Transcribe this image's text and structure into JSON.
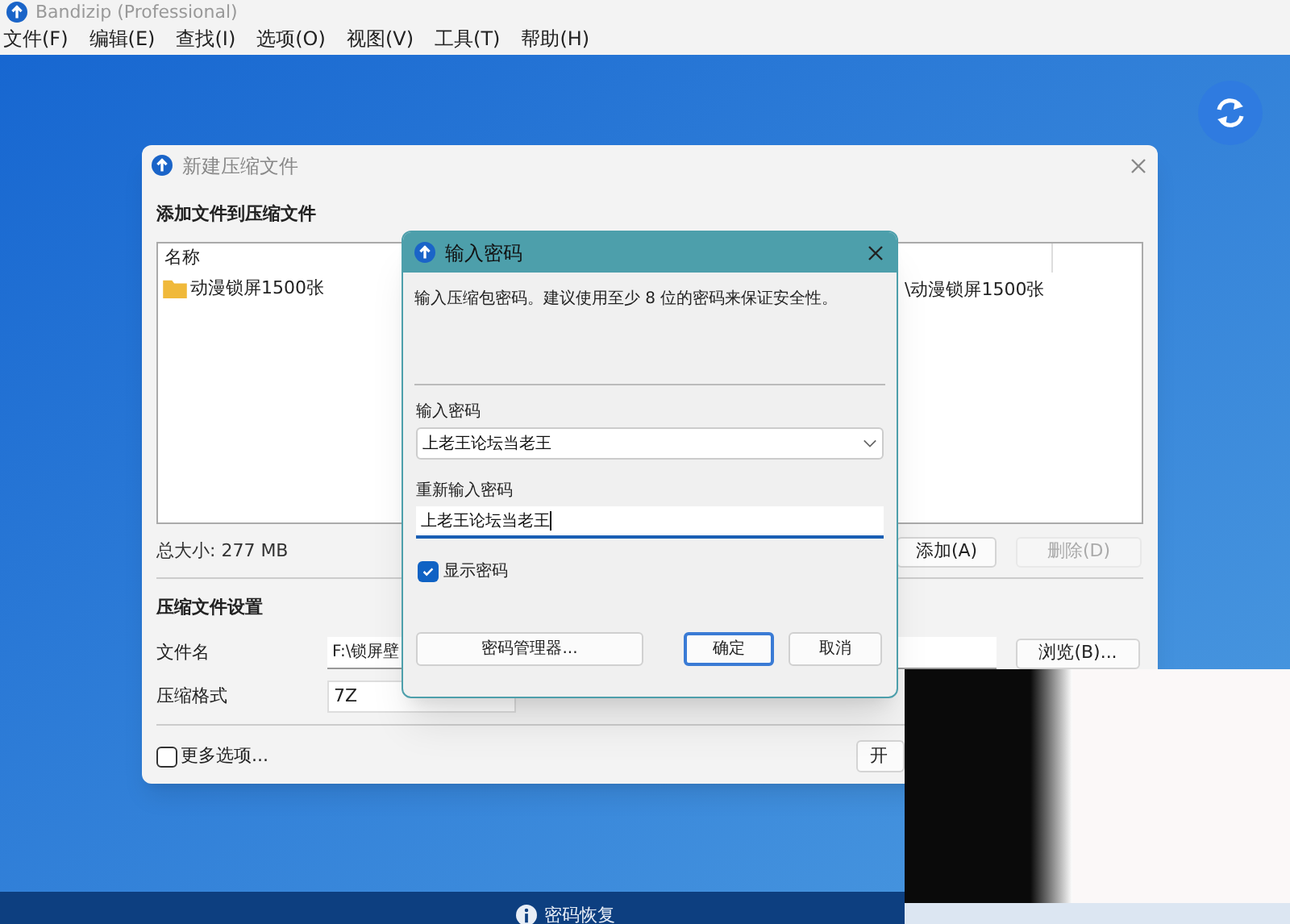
{
  "app_window": {
    "title": "Bandizip (Professional)",
    "menu": [
      "文件(F)",
      "编辑(E)",
      "查找(I)",
      "选项(O)",
      "视图(V)",
      "工具(T)",
      "帮助(H)"
    ]
  },
  "new_archive_dialog": {
    "title": "新建压缩文件",
    "files_heading": "添加文件到压缩文件",
    "file_list": {
      "columns": [
        "名称"
      ],
      "rows": [
        {
          "name": "动漫锁屏1500张",
          "path": "\\动漫锁屏1500张"
        }
      ]
    },
    "total_size": "总大小: 277 MB",
    "list_buttons": [
      {
        "label": "添加(A)",
        "disabled": false
      },
      {
        "label": "删除(D)",
        "disabled": true
      }
    ],
    "settings_heading": "压缩文件设置",
    "filename": {
      "label": "文件名",
      "value": "F:\\锁屏壁"
    },
    "browse_button": "浏览(B)...",
    "format": {
      "label": "压缩格式",
      "value": "7Z"
    },
    "more_options": {
      "label": "更多选项...",
      "checked": false
    },
    "start_button": "开"
  },
  "password_dialog": {
    "title": "输入密码",
    "description": "输入压缩包密码。建议使用至少 8 位的密码来保证安全性。",
    "password": {
      "label": "输入密码",
      "value": "上老王论坛当老王"
    },
    "confirm_password": {
      "label": "重新输入密码",
      "value": "上老王论坛当老王"
    },
    "show_password": {
      "label": "显示密码",
      "checked": true
    },
    "buttons": [
      {
        "label": "密码管理器...",
        "default": false
      },
      {
        "label": "确定",
        "default": true
      },
      {
        "label": "取消",
        "default": false
      }
    ]
  },
  "bottom_bar": {
    "label": "密码恢复"
  }
}
